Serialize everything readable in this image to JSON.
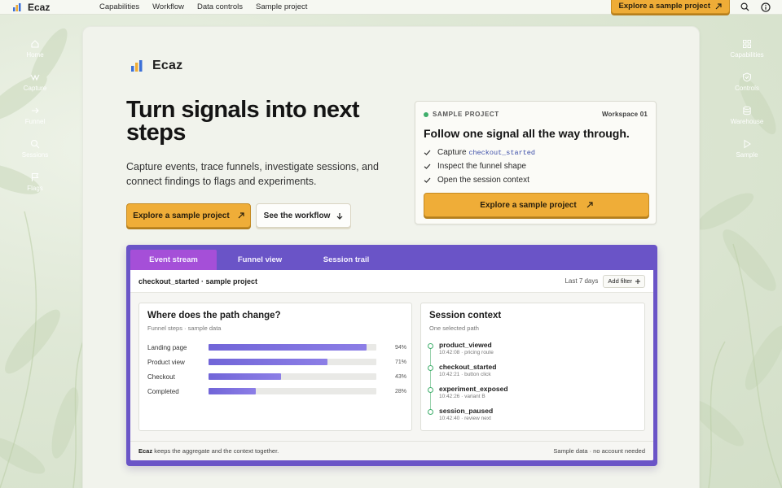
{
  "brand": {
    "name": "Ecaz"
  },
  "topnav": {
    "links": [
      "Capabilities",
      "Workflow",
      "Data controls",
      "Sample project"
    ],
    "cta": "Explore a sample project"
  },
  "left_rail": [
    {
      "label": "Home",
      "icon": "home-icon"
    },
    {
      "label": "Capture",
      "icon": "capture-icon"
    },
    {
      "label": "Funnel",
      "icon": "arrow-right-icon"
    },
    {
      "label": "Sessions",
      "icon": "search-icon"
    },
    {
      "label": "Flags",
      "icon": "flag-icon"
    }
  ],
  "right_rail": [
    {
      "label": "Capabilities",
      "icon": "grid-icon"
    },
    {
      "label": "Controls",
      "icon": "shield-icon"
    },
    {
      "label": "Warehouse",
      "icon": "database-icon"
    },
    {
      "label": "Sample",
      "icon": "play-icon"
    }
  ],
  "hero": {
    "title": "Turn signals into next steps",
    "subtitle": "Capture events, trace funnels, investigate sessions, and connect findings to flags and experiments.",
    "primary_button": "Explore a sample project",
    "secondary_button": "See the workflow"
  },
  "sample_card": {
    "eyebrow": "SAMPLE PROJECT",
    "workspace": "Workspace 01",
    "title": "Follow one signal all the way through.",
    "check_1_prefix": "Capture",
    "check_1_code": "checkout_started",
    "check_2": "Inspect the funnel shape",
    "check_3": "Open the session context",
    "button": "Explore a sample project",
    "status_color": "#3fae6b"
  },
  "app": {
    "tabs": [
      "Event stream",
      "Funnel view",
      "Session trail"
    ],
    "active_tab": "Event stream",
    "header_title": "checkout_started · sample project",
    "range": "Last 7 days",
    "filter_button": "Add filter",
    "funnel": {
      "title": "Where does the path change?",
      "subtitle": "Funnel steps · sample data",
      "steps": [
        {
          "label": "Landing page",
          "pct": 94,
          "pct_text": "94%"
        },
        {
          "label": "Product view",
          "pct": 71,
          "pct_text": "71%"
        },
        {
          "label": "Checkout",
          "pct": 43,
          "pct_text": "43%"
        },
        {
          "label": "Completed",
          "pct": 28,
          "pct_text": "28%"
        }
      ]
    },
    "session": {
      "title": "Session context",
      "subtitle": "One selected path",
      "events": [
        {
          "name": "product_viewed",
          "meta": "10:42:08 · pricing route"
        },
        {
          "name": "checkout_started",
          "meta": "10:42:21 · button click"
        },
        {
          "name": "experiment_exposed",
          "meta": "10:42:26 · variant B"
        },
        {
          "name": "session_paused",
          "meta": "10:42:40 · review next"
        }
      ]
    },
    "footer_brand": "Ecaz",
    "footer_left": "keeps the aggregate and the context together.",
    "footer_right": "Sample data · no account needed",
    "accent": "#6a54c7",
    "active_tab_color": "#a54fd8"
  },
  "colors": {
    "cta": "#efad38",
    "background": "#e3ebdc"
  }
}
